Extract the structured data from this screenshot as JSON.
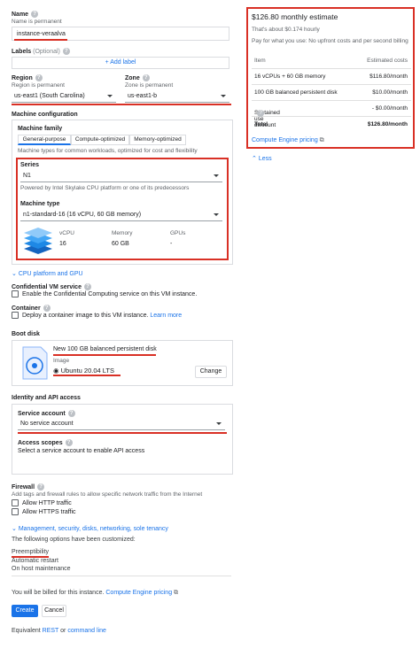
{
  "name": {
    "label": "Name",
    "sub": "Name is permanent",
    "value": "instance-veraalva"
  },
  "labels": {
    "label": "Labels",
    "optional": "(Optional)",
    "add_label": "Add label"
  },
  "region": {
    "label": "Region",
    "sub": "Region is permanent",
    "value": "us-east1 (South Carolina)"
  },
  "zone": {
    "label": "Zone",
    "sub": "Zone is permanent",
    "value": "us-east1-b"
  },
  "machine_config": {
    "label": "Machine configuration",
    "family_label": "Machine family",
    "tabs": [
      "General-purpose",
      "Compute-optimized",
      "Memory-optimized"
    ],
    "family_desc": "Machine types for common workloads, optimized for cost and flexibility",
    "series_label": "Series",
    "series_value": "N1",
    "series_desc": "Powered by Intel Skylake CPU platform or one of its predecessors",
    "type_label": "Machine type",
    "type_value": "n1-standard-16 (16 vCPU, 60 GB memory)",
    "specs": [
      {
        "header": "vCPU",
        "value": "16"
      },
      {
        "header": "Memory",
        "value": "60 GB"
      },
      {
        "header": "GPUs",
        "value": "-"
      }
    ],
    "cpu_platform_link": "CPU platform and GPU"
  },
  "confidential": {
    "label": "Confidential VM service",
    "option": "Enable the Confidential Computing service on this VM instance."
  },
  "container": {
    "label": "Container",
    "option": "Deploy a container image to this VM instance.",
    "learn_more": "Learn more"
  },
  "boot_disk": {
    "label": "Boot disk",
    "disk_name": "New 100 GB balanced persistent disk",
    "image_label": "Image",
    "image_value": "Ubuntu 20.04 LTS",
    "change": "Change"
  },
  "identity": {
    "label": "Identity and API access",
    "service_account_label": "Service account",
    "service_account_value": "No service account",
    "scopes_label": "Access scopes",
    "scopes_desc": "Select a service account to enable API access"
  },
  "firewall": {
    "label": "Firewall",
    "desc": "Add tags and firewall rules to allow specific network traffic from the Internet",
    "http": "Allow HTTP traffic",
    "https": "Allow HTTPS traffic"
  },
  "management_link": "Management, security, disks, networking, sole tenancy",
  "customized": {
    "intro": "The following options have been customized:",
    "items": [
      "Preemptibility",
      "Automatic restart",
      "On host maintenance"
    ]
  },
  "billing": {
    "text": "You will be billed for this instance.",
    "link": "Compute Engine pricing"
  },
  "buttons": {
    "create": "Create",
    "cancel": "Cancel"
  },
  "equivalent": {
    "prefix": "Equivalent",
    "rest": "REST",
    "or": "or",
    "command_line": "command line"
  },
  "estimate": {
    "title": "$126.80 monthly estimate",
    "hourly": "That's about $0.174 hourly",
    "note": "Pay for what you use: No upfront costs and per second billing",
    "col_item": "Item",
    "col_cost": "Estimated costs",
    "rows": [
      {
        "item": "16 vCPUs + 60 GB memory",
        "cost": "$116.80/month"
      },
      {
        "item": "100 GB balanced persistent disk",
        "cost": "$10.00/month"
      },
      {
        "item": "Sustained use discount",
        "cost": "- $0.00/month"
      }
    ],
    "total_label": "Total",
    "total_value": "$126.80/month",
    "pricing_link": "Compute Engine pricing",
    "less": "Less"
  },
  "colors": {
    "accent": "#1a73e8",
    "highlight": "#d93025"
  }
}
